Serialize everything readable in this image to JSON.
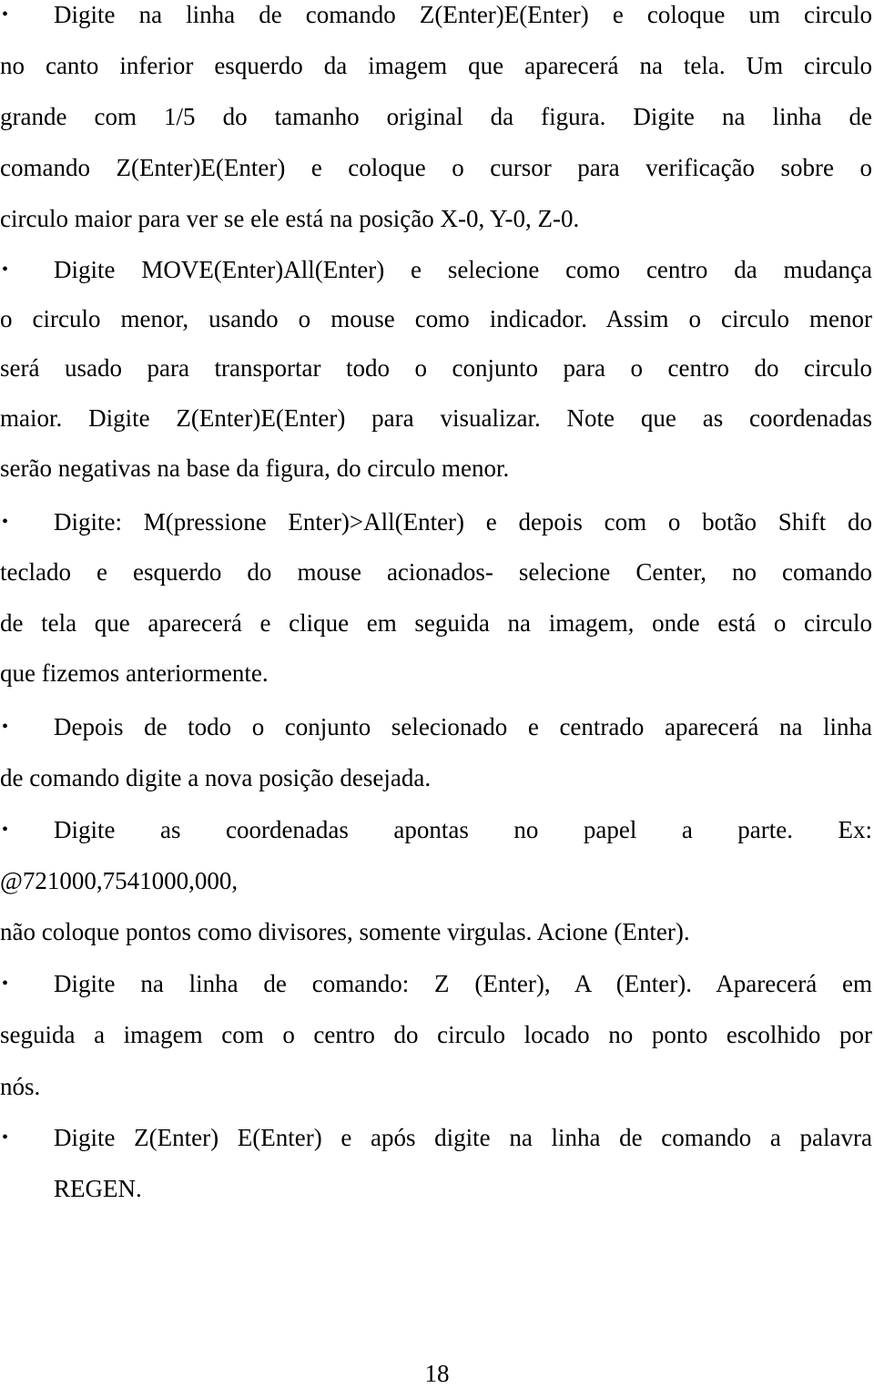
{
  "document": {
    "bullet_symbol": "•",
    "items": [
      {
        "lines": [
          "Digite na linha de comando Z(Enter)E(Enter) e coloque um circulo",
          "no canto inferior esquerdo da imagem que aparecerá na tela. Um circulo",
          "grande com 1/5 do tamanho original da figura. Digite na linha de",
          "comando Z(Enter)E(Enter) e coloque o cursor para verificação sobre o",
          "circulo maior para ver se ele está na posição X-0, Y-0, Z-0."
        ]
      },
      {
        "lines": [
          "Digite MOVE(Enter)All(Enter) e selecione como centro da mudança",
          "o circulo menor, usando o mouse como indicador. Assim o circulo menor",
          "será usado para transportar todo o conjunto para o centro do circulo",
          "maior. Digite Z(Enter)E(Enter) para visualizar. Note que as coordenadas",
          "serão negativas na base da figura, do circulo menor."
        ]
      },
      {
        "lines": [
          "Digite: M(pressione Enter)>All(Enter) e depois com o botão Shift do",
          "teclado e esquerdo do mouse acionados- selecione  Center, no comando",
          "de tela que aparecerá e clique em seguida na imagem, onde está o circulo",
          "que fizemos anteriormente."
        ]
      },
      {
        "lines": [
          "Depois de todo o conjunto selecionado e centrado aparecerá na linha",
          "de comando digite a nova posição desejada."
        ]
      },
      {
        "lines": [
          "Digite as coordenadas apontas no papel a parte. Ex:",
          "@721000,7541000,000,",
          "não coloque pontos como divisores, somente virgulas. Acione (Enter)."
        ]
      },
      {
        "lines": [
          "Digite na linha de comando: Z (Enter), A (Enter). Aparecerá em",
          "seguida a imagem com o centro do circulo locado no ponto escolhido por",
          "nós."
        ]
      },
      {
        "lines": [
          "Digite Z(Enter) E(Enter) e após digite na linha de comando a palavra",
          "REGEN."
        ]
      }
    ],
    "page_number": "18"
  }
}
